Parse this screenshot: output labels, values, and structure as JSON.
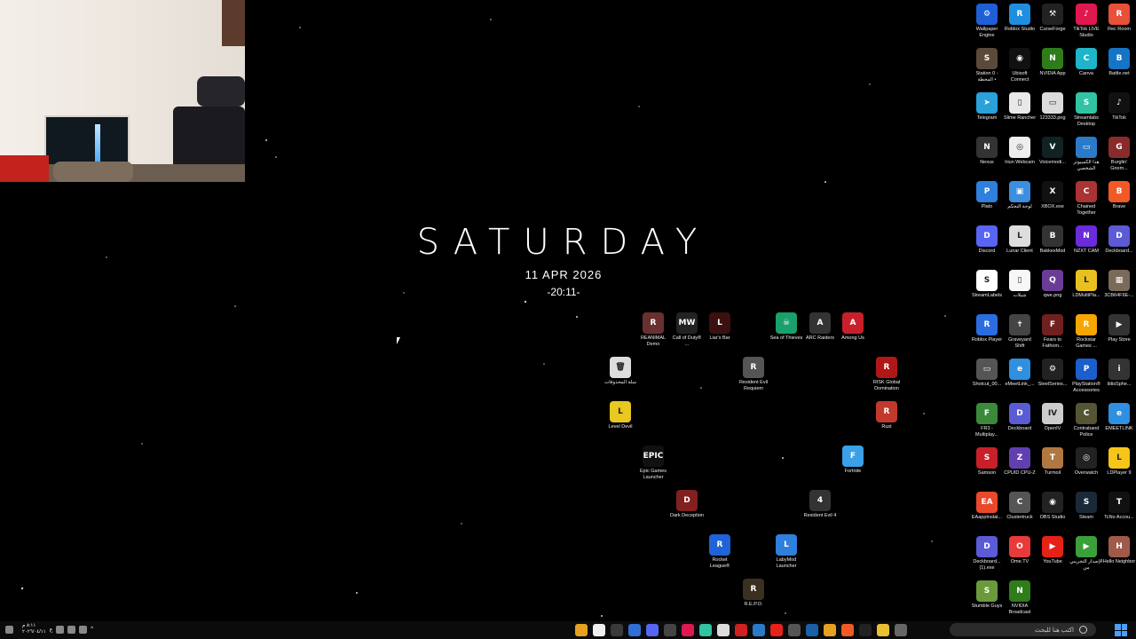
{
  "clock": {
    "day": "SATURDAY",
    "date": "11 APR 2026",
    "time": "-20:11-"
  },
  "right_icons": [
    {
      "label": "Wallpaper Engine",
      "color": "#1e5fd6",
      "glyph": "⚙"
    },
    {
      "label": "Roblox Studio",
      "color": "#1f8ee0",
      "glyph": "R"
    },
    {
      "label": "CurseForge",
      "color": "#222",
      "glyph": "⚒"
    },
    {
      "label": "TikTok LIVE Studio",
      "color": "#e01850",
      "glyph": "♪"
    },
    {
      "label": "Rec Room",
      "color": "#e8503a",
      "glyph": "R"
    },
    {
      "label": "Station 0 - المحطة •",
      "color": "#5a4a3a",
      "glyph": "S"
    },
    {
      "label": "Ubisoft Connect",
      "color": "#111",
      "glyph": "◉"
    },
    {
      "label": "NVIDIA App",
      "color": "#2f7d1a",
      "glyph": "N"
    },
    {
      "label": "Canva",
      "color": "#1fb5c8",
      "glyph": "C"
    },
    {
      "label": "Battle.net",
      "color": "#1574c4",
      "glyph": "B"
    },
    {
      "label": "Telegram",
      "color": "#2aa1da",
      "glyph": "➤"
    },
    {
      "label": "Slime Rancher",
      "color": "#e8e8e8",
      "glyph": "▯"
    },
    {
      "label": "123333.png",
      "color": "#dcdcdc",
      "glyph": "▭"
    },
    {
      "label": "Streamlabs Desktop",
      "color": "#31c3a2",
      "glyph": "S"
    },
    {
      "label": "TikTok",
      "color": "#111",
      "glyph": "♪"
    },
    {
      "label": "Nexus",
      "color": "#333",
      "glyph": "N"
    },
    {
      "label": "Iriun Webcam",
      "color": "#eee",
      "glyph": "◎"
    },
    {
      "label": "Voicemodi...",
      "color": "#122",
      "glyph": "V"
    },
    {
      "label": "هذا الكمبيوتر الشخصي",
      "color": "#2a7ac9",
      "glyph": "▭"
    },
    {
      "label": "Burglin' Gnom...",
      "color": "#8a2b2b",
      "glyph": "G"
    },
    {
      "label": "Plato",
      "color": "#2f7fdd",
      "glyph": "P"
    },
    {
      "label": "لوحة التحكم",
      "color": "#3b8ee0",
      "glyph": "▣"
    },
    {
      "label": "XBOX.exe",
      "color": "#111",
      "glyph": "X"
    },
    {
      "label": "Chained Together",
      "color": "#a33",
      "glyph": "C"
    },
    {
      "label": "Brave",
      "color": "#f25a25",
      "glyph": "B"
    },
    {
      "label": "Discord",
      "color": "#5865f2",
      "glyph": "D"
    },
    {
      "label": "Lunar Client",
      "color": "#ddd",
      "glyph": "L"
    },
    {
      "label": "BakkesMod",
      "color": "#333",
      "glyph": "B"
    },
    {
      "label": "NZXT CAM",
      "color": "#6a2bd9",
      "glyph": "N"
    },
    {
      "label": "Deckboard...",
      "color": "#5b5bd6",
      "glyph": "D"
    },
    {
      "label": "StreamLabels",
      "color": "#fff",
      "glyph": "S"
    },
    {
      "label": "شيلات",
      "color": "#f7f7f7",
      "glyph": "▯"
    },
    {
      "label": "qwe.png",
      "color": "#6b3c96",
      "glyph": "Q"
    },
    {
      "label": "LDMultiPla...",
      "color": "#e8c021",
      "glyph": "L"
    },
    {
      "label": "3CB64F9E-...",
      "color": "#7a6a5a",
      "glyph": "▦"
    },
    {
      "label": "Roblox Player",
      "color": "#2b6de0",
      "glyph": "R"
    },
    {
      "label": "Graveyard Shift",
      "color": "#444",
      "glyph": "✝"
    },
    {
      "label": "Fears to Fathom...",
      "color": "#702020",
      "glyph": "F"
    },
    {
      "label": "Rockstar Games ...",
      "color": "#f7a500",
      "glyph": "R"
    },
    {
      "label": "Play Store",
      "color": "#333",
      "glyph": "▶"
    },
    {
      "label": "Shotcut_00...",
      "color": "#555",
      "glyph": "▭"
    },
    {
      "label": "eMeetLink_...",
      "color": "#2f8fe0",
      "glyph": "e"
    },
    {
      "label": "SteelSeries...",
      "color": "#222",
      "glyph": "⚙"
    },
    {
      "label": "PlayStation® Accessories",
      "color": "#1a5fcc",
      "glyph": "P"
    },
    {
      "label": "iblisSphe...",
      "color": "#333",
      "glyph": "i"
    },
    {
      "label": "FR3 - Multiplay...",
      "color": "#3a8a3a",
      "glyph": "F"
    },
    {
      "label": "Deckboard",
      "color": "#5b5bd6",
      "glyph": "D"
    },
    {
      "label": "OpenIV",
      "color": "#ccc",
      "glyph": "IV"
    },
    {
      "label": "Contraband Police",
      "color": "#553",
      "glyph": "C"
    },
    {
      "label": "EMEETLINK",
      "color": "#2f8fe0",
      "glyph": "e"
    },
    {
      "label": "Samson",
      "color": "#c8202a",
      "glyph": "S"
    },
    {
      "label": "CPUID CPU-Z",
      "color": "#6040b0",
      "glyph": "Z"
    },
    {
      "label": "Turmoil",
      "color": "#b07840",
      "glyph": "T"
    },
    {
      "label": "Overwatch",
      "color": "#222",
      "glyph": "◎"
    },
    {
      "label": "LDPlayer 9",
      "color": "#f5c518",
      "glyph": "L"
    },
    {
      "label": "EAappInstal...",
      "color": "#e8492b",
      "glyph": "EA"
    },
    {
      "label": "Clustertruck",
      "color": "#555",
      "glyph": "C"
    },
    {
      "label": "OBS Studio",
      "color": "#222",
      "glyph": "◉"
    },
    {
      "label": "Steam",
      "color": "#1b2838",
      "glyph": "S"
    },
    {
      "label": "TcNo Accou...",
      "color": "#111",
      "glyph": "T"
    },
    {
      "label": "Deckboard... (1).exe",
      "color": "#5b5bd6",
      "glyph": "D"
    },
    {
      "label": "Ome.TV",
      "color": "#e83a3a",
      "glyph": "O"
    },
    {
      "label": "YouTube",
      "color": "#e62117",
      "glyph": "▶"
    },
    {
      "label": "الإصدار التجريبي من",
      "color": "#3aa03a",
      "glyph": "▶"
    },
    {
      "label": "Hello Neighbor",
      "color": "#a05a4a",
      "glyph": "H"
    },
    {
      "label": "Stumble Guys",
      "color": "#6a9a3a",
      "glyph": "S"
    },
    {
      "label": "NVIDIA Broadcast",
      "color": "#2f7d1a",
      "glyph": "N"
    }
  ],
  "center_icons": [
    {
      "label": "REANIMAL Demo",
      "color": "#6a3030",
      "glyph": "R"
    },
    {
      "label": "Call of Duty® ...",
      "color": "#222",
      "glyph": "MW"
    },
    {
      "label": "Liar's Bar",
      "color": "#3a1010",
      "glyph": "L"
    },
    {
      "label": "Sea of Thieves",
      "color": "#1aa06a",
      "glyph": "☠"
    },
    {
      "label": "ARC Raiders",
      "color": "#333",
      "glyph": "A"
    },
    {
      "label": "Among Us",
      "color": "#c8202a",
      "glyph": "A"
    },
    {
      "label": "سلة المحذوفات",
      "color": "#ddd",
      "glyph": "🗑"
    },
    {
      "label": "Resident Evil Requiem",
      "color": "#555",
      "glyph": "R"
    },
    {
      "label": "RISK Global Domination",
      "color": "#b01818",
      "glyph": "R"
    },
    {
      "label": "Level Devil",
      "color": "#e8c821",
      "glyph": "L"
    },
    {
      "label": "Rust",
      "color": "#c0392b",
      "glyph": "R"
    },
    {
      "label": "Epic Games Launcher",
      "color": "#111",
      "glyph": "EPIC"
    },
    {
      "label": "Fortnite",
      "color": "#3aa0e8",
      "glyph": "F"
    },
    {
      "label": "Dark Deception",
      "color": "#802020",
      "glyph": "D"
    },
    {
      "label": "Resident Evil 4",
      "color": "#333",
      "glyph": "4"
    },
    {
      "label": "Rocket League®",
      "color": "#1f63d6",
      "glyph": "R"
    },
    {
      "label": "LabyMod Launcher",
      "color": "#2f7fdd",
      "glyph": "L"
    },
    {
      "label": "R.E.P.O.",
      "color": "#3a3020",
      "glyph": "R"
    }
  ],
  "taskbar": {
    "clock_time": "٨:١١ م",
    "clock_date": "٢٠٢٦/٠٤/١١",
    "lang": "ع",
    "search_placeholder": "اكتب هنا للبحث",
    "apps": [
      {
        "name": "chrome-icon",
        "color": "#e8a020"
      },
      {
        "name": "iriun-icon",
        "color": "#eee"
      },
      {
        "name": "xbox-icon",
        "color": "#3a3a3a"
      },
      {
        "name": "files-icon",
        "color": "#2f6fd6"
      },
      {
        "name": "discord-icon",
        "color": "#5865f2"
      },
      {
        "name": "steam-circle-icon",
        "color": "#444"
      },
      {
        "name": "tiktok-icon",
        "color": "#e01850"
      },
      {
        "name": "streamlabs-icon",
        "color": "#31c3a2"
      },
      {
        "name": "capcut-icon",
        "color": "#ddd"
      },
      {
        "name": "adobe-icon",
        "color": "#d02020"
      },
      {
        "name": "editor-icon",
        "color": "#2a7ac9"
      },
      {
        "name": "youtube-icon",
        "color": "#e62117"
      },
      {
        "name": "monitor-icon",
        "color": "#555"
      },
      {
        "name": "steam-icon",
        "color": "#1b5fa8"
      },
      {
        "name": "chrome-active-icon",
        "color": "#e8a020"
      },
      {
        "name": "brave-icon",
        "color": "#f25a25"
      },
      {
        "name": "tiktok-live-icon",
        "color": "#222"
      },
      {
        "name": "folder-icon",
        "color": "#e8c030"
      },
      {
        "name": "task-view-icon",
        "color": "#666"
      }
    ]
  }
}
